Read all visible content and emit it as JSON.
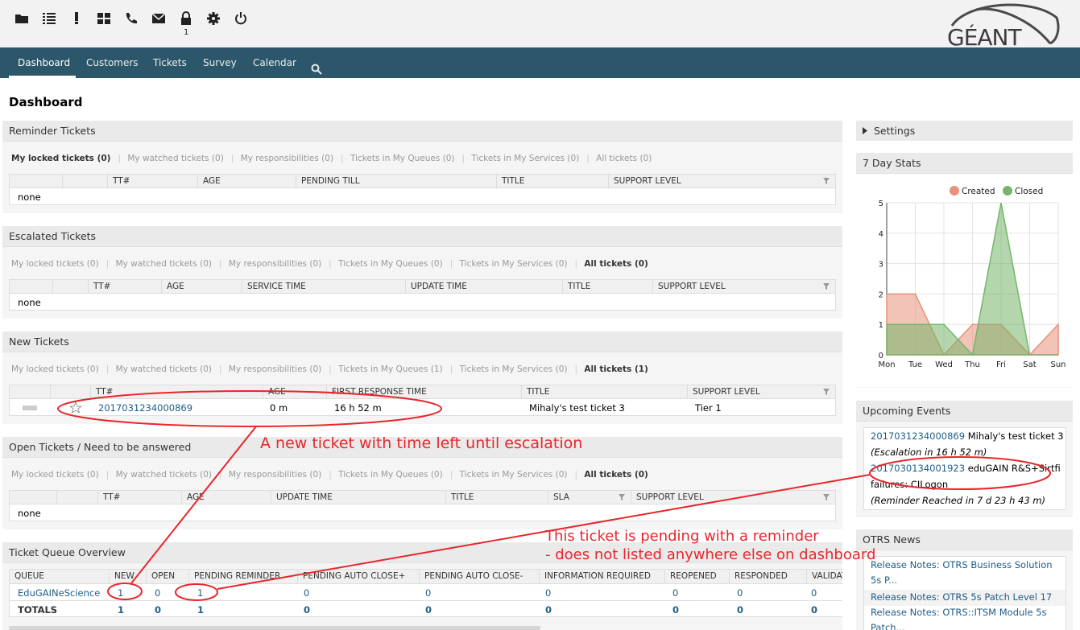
{
  "toolbar": {
    "icons": [
      "folder-icon",
      "list-icon",
      "exclamation-icon",
      "grid-icon",
      "phone-icon",
      "envelope-icon",
      "lock-icon",
      "gear-icon",
      "power-icon"
    ],
    "locked_count": "1",
    "logo_text": "GÉANT"
  },
  "nav": {
    "items": [
      "Dashboard",
      "Customers",
      "Tickets",
      "Survey",
      "Calendar"
    ],
    "search_icon": "search-icon"
  },
  "page_title": "Dashboard",
  "reminder": {
    "title": "Reminder Tickets",
    "filters": [
      "My locked tickets (0)",
      "My watched tickets (0)",
      "My responsibilities (0)",
      "Tickets in My Queues (0)",
      "Tickets in My Services (0)",
      "All tickets (0)"
    ],
    "columns": [
      "TT#",
      "AGE",
      "PENDING TILL",
      "TITLE",
      "SUPPORT LEVEL"
    ],
    "empty": "none"
  },
  "escalated": {
    "title": "Escalated Tickets",
    "filters": [
      "My locked tickets (0)",
      "My watched tickets (0)",
      "My responsibilities (0)",
      "Tickets in My Queues (0)",
      "Tickets in My Services (0)",
      "All tickets (0)"
    ],
    "columns": [
      "TT#",
      "AGE",
      "SERVICE TIME",
      "UPDATE TIME",
      "TITLE",
      "SUPPORT LEVEL"
    ],
    "empty": "none"
  },
  "new_tickets": {
    "title": "New Tickets",
    "filters": [
      "My locked tickets (0)",
      "My watched tickets (0)",
      "My responsibilities (0)",
      "Tickets in My Queues (1)",
      "Tickets in My Services (0)",
      "All tickets (1)"
    ],
    "columns": [
      "TT#",
      "AGE",
      "FIRST RESPONSE TIME",
      "TITLE",
      "SUPPORT LEVEL"
    ],
    "row": {
      "tt": "2017031234000869",
      "age": "0 m",
      "first_response": "16 h 52 m",
      "title": "Mihaly's test ticket 3",
      "support": "Tier 1"
    }
  },
  "open_tickets": {
    "title": "Open Tickets / Need to be answered",
    "filters": [
      "My locked tickets (0)",
      "My watched tickets (0)",
      "My responsibilities (0)",
      "Tickets in My Queues (0)",
      "Tickets in My Services (0)",
      "All tickets (0)"
    ],
    "columns": [
      "TT#",
      "AGE",
      "UPDATE TIME",
      "TITLE",
      "SLA",
      "SUPPORT LEVEL"
    ],
    "empty": "none"
  },
  "queue_overview": {
    "title": "Ticket Queue Overview",
    "columns": [
      "QUEUE",
      "NEW",
      "OPEN",
      "PENDING REMINDER",
      "PENDING AUTO CLOSE+",
      "PENDING AUTO CLOSE-",
      "INFORMATION REQUIRED",
      "REOPENED",
      "RESPONDED",
      "VALIDAT"
    ],
    "row": [
      "EduGAINeScience",
      "1",
      "0",
      "1",
      "0",
      "0",
      "0",
      "0",
      "0",
      "0"
    ],
    "totals": [
      "TOTALS",
      "1",
      "0",
      "1",
      "0",
      "0",
      "0",
      "0",
      "0",
      "0"
    ]
  },
  "settings": {
    "label": "Settings"
  },
  "stats": {
    "title": "7 Day Stats",
    "legend": [
      "Created",
      "Closed"
    ]
  },
  "chart_data": {
    "type": "area",
    "categories": [
      "Mon",
      "Tue",
      "Wed",
      "Thu",
      "Fri",
      "Sat",
      "Sun"
    ],
    "series": [
      {
        "name": "Created",
        "values": [
          2,
          2,
          0,
          1,
          1,
          0,
          1
        ],
        "color": "#e8917c"
      },
      {
        "name": "Closed",
        "values": [
          1,
          1,
          1,
          0,
          5,
          0,
          0
        ],
        "color": "#76b56a"
      }
    ],
    "ylim": [
      0,
      5
    ],
    "yticks": [
      "0",
      "1",
      "2",
      "3",
      "4",
      "5"
    ],
    "legend_position": "top-right",
    "grid": true
  },
  "events": {
    "title": "Upcoming Events",
    "items": [
      {
        "tt": "2017031234000869",
        "title": "Mihaly's test ticket 3",
        "note": "(Escalation in 16 h 52 m)"
      },
      {
        "tt": "2017030134001923",
        "title": "eduGAIN R&S+Sirtfi",
        "title2": "failures: CILogon",
        "note": "(Reminder Reached in 7 d 23 h 43 m)"
      }
    ]
  },
  "news": {
    "title": "OTRS News",
    "items": [
      "Release Notes: OTRS Business Solution",
      "5s P...",
      "Release Notes: OTRS 5s Patch Level 17",
      "Release Notes: OTRS::ITSM Module 5s",
      "Patch..."
    ]
  },
  "annotations": {
    "new_ticket": "A new ticket with time left until escalation",
    "pending_1": "This ticket is pending with a reminder",
    "pending_2": "- does not listed anywhere else on dashboard"
  },
  "colors": {
    "nav": "#2c5669",
    "link": "#1e5d87",
    "annotation": "#e8262c"
  }
}
